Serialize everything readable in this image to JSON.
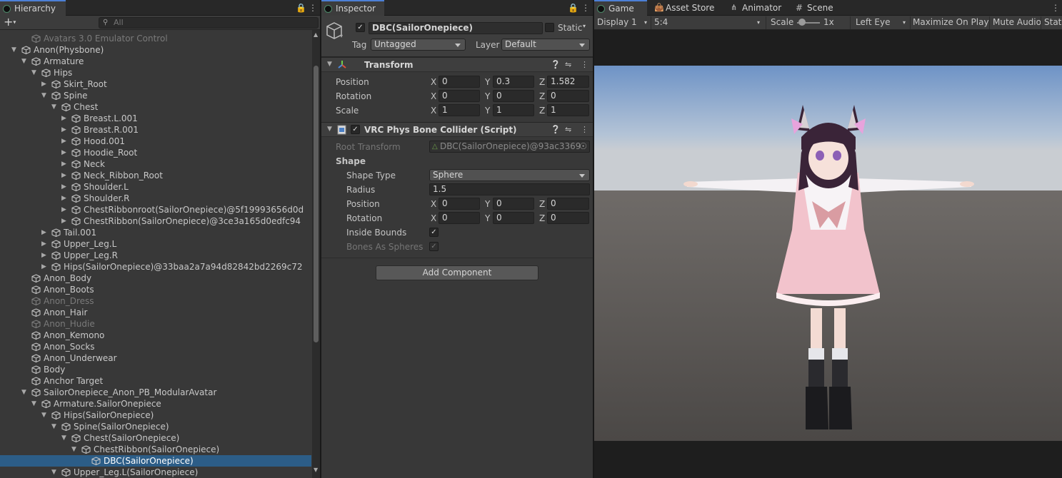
{
  "hierarchy": {
    "tab": "Hierarchy",
    "add_label": "+",
    "search_placeholder": "All",
    "rows": [
      {
        "label": "Avatars 3.0 Emulator Control",
        "depth": 4,
        "arrow": "",
        "dim": true
      },
      {
        "label": "Anon(Physbone)",
        "depth": 3,
        "arrow": "open"
      },
      {
        "label": "Armature",
        "depth": 4,
        "arrow": "open"
      },
      {
        "label": "Hips",
        "depth": 5,
        "arrow": "open"
      },
      {
        "label": "Skirt_Root",
        "depth": 6,
        "arrow": "closed"
      },
      {
        "label": "Spine",
        "depth": 6,
        "arrow": "open"
      },
      {
        "label": "Chest",
        "depth": 7,
        "arrow": "open"
      },
      {
        "label": "Breast.L.001",
        "depth": 8,
        "arrow": "closed"
      },
      {
        "label": "Breast.R.001",
        "depth": 8,
        "arrow": "closed"
      },
      {
        "label": "Hood.001",
        "depth": 8,
        "arrow": "closed"
      },
      {
        "label": "Hoodie_Root",
        "depth": 8,
        "arrow": "closed"
      },
      {
        "label": "Neck",
        "depth": 8,
        "arrow": "closed"
      },
      {
        "label": "Neck_Ribbon_Root",
        "depth": 8,
        "arrow": "closed"
      },
      {
        "label": "Shoulder.L",
        "depth": 8,
        "arrow": "closed"
      },
      {
        "label": "Shoulder.R",
        "depth": 8,
        "arrow": "closed"
      },
      {
        "label": "ChestRibbonroot(SailorOnepiece)@5f19993656d0d",
        "depth": 8,
        "arrow": "closed"
      },
      {
        "label": "ChestRibbon(SailorOnepiece)@3ce3a165d0edfc94",
        "depth": 8,
        "arrow": "closed"
      },
      {
        "label": "Tail.001",
        "depth": 6,
        "arrow": "closed"
      },
      {
        "label": "Upper_Leg.L",
        "depth": 6,
        "arrow": "closed"
      },
      {
        "label": "Upper_Leg.R",
        "depth": 6,
        "arrow": "closed"
      },
      {
        "label": "Hips(SailorOnepiece)@33baa2a7a94d82842bd2269c72",
        "depth": 6,
        "arrow": "closed"
      },
      {
        "label": "Anon_Body",
        "depth": 4,
        "arrow": ""
      },
      {
        "label": "Anon_Boots",
        "depth": 4,
        "arrow": ""
      },
      {
        "label": "Anon_Dress",
        "depth": 4,
        "arrow": "",
        "dim": true
      },
      {
        "label": "Anon_Hair",
        "depth": 4,
        "arrow": ""
      },
      {
        "label": "Anon_Hudie",
        "depth": 4,
        "arrow": "",
        "dim": true
      },
      {
        "label": "Anon_Kemono",
        "depth": 4,
        "arrow": ""
      },
      {
        "label": "Anon_Socks",
        "depth": 4,
        "arrow": ""
      },
      {
        "label": "Anon_Underwear",
        "depth": 4,
        "arrow": ""
      },
      {
        "label": "Body",
        "depth": 4,
        "arrow": ""
      },
      {
        "label": "Anchor Target",
        "depth": 4,
        "arrow": ""
      },
      {
        "label": "SailorOnepiece_Anon_PB_ModularAvatar",
        "depth": 4,
        "arrow": "open"
      },
      {
        "label": "Armature.SailorOnepiece",
        "depth": 5,
        "arrow": "open"
      },
      {
        "label": "Hips(SailorOnepiece)",
        "depth": 6,
        "arrow": "open"
      },
      {
        "label": "Spine(SailorOnepiece)",
        "depth": 7,
        "arrow": "open"
      },
      {
        "label": "Chest(SailorOnepiece)",
        "depth": 8,
        "arrow": "open"
      },
      {
        "label": "ChestRibbon(SailorOnepiece)",
        "depth": 9,
        "arrow": "open"
      },
      {
        "label": "DBC(SailorOnepiece)",
        "depth": 10,
        "arrow": "",
        "selected": true
      },
      {
        "label": "Upper_Leg.L(SailorOnepiece)",
        "depth": 7,
        "arrow": "open"
      }
    ]
  },
  "inspector": {
    "tab": "Inspector",
    "object_name": "DBC(SailorOnepiece)",
    "static_label": "Static",
    "tag_label": "Tag",
    "tag_value": "Untagged",
    "layer_label": "Layer",
    "layer_value": "Default",
    "transform": {
      "title": "Transform",
      "position_label": "Position",
      "rotation_label": "Rotation",
      "scale_label": "Scale",
      "position": {
        "x": "0",
        "y": "0.3",
        "z": "1.582"
      },
      "rotation": {
        "x": "0",
        "y": "0",
        "z": "0"
      },
      "scale": {
        "x": "1",
        "y": "1",
        "z": "1"
      }
    },
    "collider": {
      "title": "VRC Phys Bone Collider (Script)",
      "root_transform_label": "Root Transform",
      "root_transform_value": "DBC(SailorOnepiece)@93ac3369",
      "shape_header": "Shape",
      "shape_type_label": "Shape Type",
      "shape_type_value": "Sphere",
      "radius_label": "Radius",
      "radius_value": "1.5",
      "position_label": "Position",
      "rotation_label": "Rotation",
      "position": {
        "x": "0",
        "y": "0",
        "z": "0"
      },
      "rotation": {
        "x": "0",
        "y": "0",
        "z": "0"
      },
      "inside_bounds_label": "Inside Bounds",
      "bones_as_spheres_label": "Bones As Spheres"
    },
    "add_component": "Add Component",
    "axis": {
      "x": "X",
      "y": "Y",
      "z": "Z"
    }
  },
  "game": {
    "tabs": [
      "Game",
      "Asset Store",
      "Animator",
      "Scene"
    ],
    "display": "Display 1",
    "aspect": "5:4",
    "scale_label": "Scale",
    "scale_value": "1x",
    "eye": "Left Eye",
    "maximize": "Maximize On Play",
    "mute": "Mute Audio",
    "stats": "Stat"
  }
}
